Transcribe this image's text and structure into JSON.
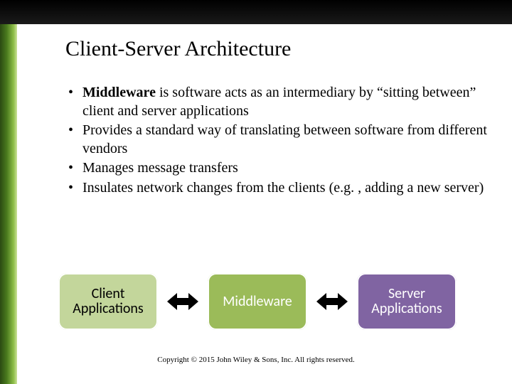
{
  "title": "Client-Server Architecture",
  "bullets": [
    {
      "bold": "Middleware",
      "rest": " is software acts as an intermediary by “sitting between” client and server applications"
    },
    {
      "bold": "",
      "rest": "Provides a standard way of translating between software from different vendors"
    },
    {
      "bold": "",
      "rest": "Manages message transfers"
    },
    {
      "bold": "",
      "rest": "Insulates network changes from the clients (e.g. ,  adding a new server)"
    }
  ],
  "diagram": {
    "client": "Client Applications",
    "middleware": "Middleware",
    "server": "Server Applications"
  },
  "copyright": "Copyright © 2015 John Wiley & Sons, Inc. All rights reserved."
}
